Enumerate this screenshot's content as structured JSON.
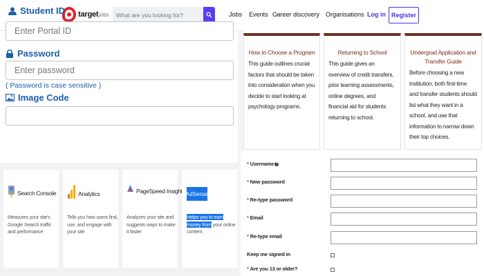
{
  "nav": {
    "logo_text": "target",
    "logo_sub": "jobs",
    "search_placeholder": "What are you looking for?",
    "links": {
      "jobs": "Jobs",
      "events": "Events",
      "career": "Career discovery",
      "orgs": "Organisations",
      "login": "Log in"
    },
    "signup": "Register"
  },
  "login": {
    "student_id_label": "Student ID",
    "portal_placeholder": "Enter Portal ID",
    "password_label": "Password",
    "password_placeholder": "Enter password",
    "case_note": "( Password is case sensitive )",
    "image_code_label": "Image Code"
  },
  "tools": [
    {
      "name": "Search Console",
      "desc": "Measures your site's Google Search traffic and performance"
    },
    {
      "name": "Analytics",
      "desc": "Tells you how users find, use, and engage with your site"
    },
    {
      "name": "PageSpeed Insights",
      "desc": "Analyzes your site and suggests ways to make it faster"
    },
    {
      "name": "AdSense",
      "desc_highlight": "Helps you to earn money from",
      "desc_rest": "your online content"
    }
  ],
  "guides": [
    {
      "title": "How to Choose a Program",
      "body": "This guide outlines crucial factors that should be taken into consideration when you decide to start looking at psychology programs."
    },
    {
      "title": "Returning to School",
      "body": "This guide gives an overview of credit transfers, prior learning assessments, online degrees, and financial aid for students returning to school."
    },
    {
      "title": "Undergrad Application and Transfer Guide",
      "body": "Before choosing a new institution, both first-time and transfer students should list what they want in a school, and use that information to narrow down their top choices."
    }
  ],
  "form": {
    "username": "Username",
    "new_password": "New password",
    "retype_password": "Re-type password",
    "email": "Email",
    "retype_email": "Re-type email",
    "keep_signed": "Keep me signed in",
    "age_question": "Are you 13 or older?",
    "asterisk": "*"
  },
  "colors": {
    "brand_red": "#e0232a",
    "accent_purple": "#4b2fdc",
    "label_blue": "#1c5ea8",
    "guide_title": "#7a2a17",
    "adsense_blue": "#1a73e8"
  }
}
